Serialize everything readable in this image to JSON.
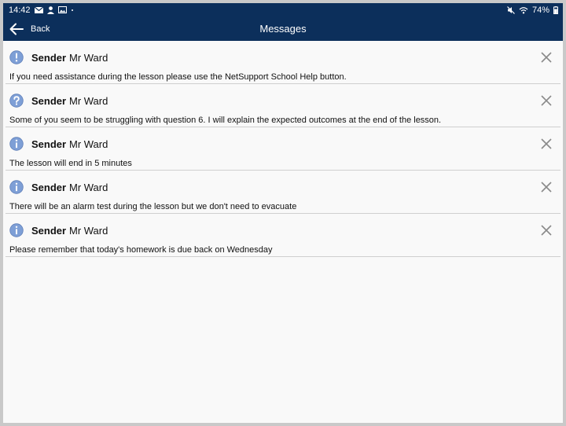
{
  "status_bar": {
    "time": "14:42",
    "left_icons": [
      "mail-icon",
      "person-icon",
      "image-icon",
      "dot-icon"
    ],
    "right_icons": [
      "mute-icon",
      "wifi-icon"
    ],
    "battery": "74%"
  },
  "app_bar": {
    "back_label": "Back",
    "title": "Messages"
  },
  "messages": [
    {
      "icon": "exclamation-icon",
      "sender_label": "Sender",
      "sender": "Mr Ward",
      "text": "If you need assistance during the lesson please use the NetSupport School Help button."
    },
    {
      "icon": "question-icon",
      "sender_label": "Sender",
      "sender": "Mr Ward",
      "text": "Some of you seem to be struggling with question 6. I will explain the expected outcomes at the end of the lesson."
    },
    {
      "icon": "info-icon",
      "sender_label": "Sender",
      "sender": "Mr Ward",
      "text": "The lesson will end in 5 minutes"
    },
    {
      "icon": "info-icon",
      "sender_label": "Sender",
      "sender": "Mr Ward",
      "text": "There will be an alarm test during the lesson but we don't need to evacuate"
    },
    {
      "icon": "info-icon",
      "sender_label": "Sender",
      "sender": "Mr Ward",
      "text": "Please remember that today's homework is due back on Wednesday"
    }
  ],
  "colors": {
    "header_bg": "#0c2f5b",
    "page_bg": "#f9f9f9",
    "icon_blue": "#7e9fd6"
  }
}
